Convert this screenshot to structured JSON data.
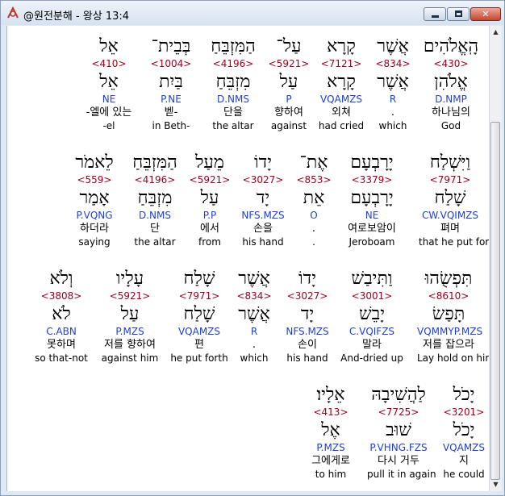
{
  "window": {
    "title": "@원전분해 - 왕상 13:4",
    "close_glyph": "✕"
  },
  "colors": {
    "strong_number": "#a0001e",
    "parsing": "#1f3fd0",
    "title_bar": "#d7e2f0"
  },
  "rows": [
    {
      "words": [
        {
          "heb": "הָֽאֱלֹהִים",
          "num": "<430>",
          "lemma": "אֱלֹהִן",
          "parse": "D.NMP",
          "kor": "하나님의",
          "eng": "God"
        },
        {
          "heb": "אֲשֶׁר",
          "num": "<834>",
          "lemma": "אֲשֶׁר",
          "parse": "R",
          "kor": ".",
          "eng": "which"
        },
        {
          "heb": "קָרָא",
          "num": "<7121>",
          "lemma": "קָרָא",
          "parse": "VQAMZS",
          "kor": "외쳐",
          "eng": "had cried"
        },
        {
          "heb": "עַל־",
          "num": "<5921>",
          "lemma": "עַל",
          "parse": "P",
          "kor": "향하여",
          "eng": "against"
        },
        {
          "heb": "הַמִּזְבֵּחַ",
          "num": "<4196>",
          "lemma": "מִזְבֵּחַ",
          "parse": "D.NMS",
          "kor": "단을",
          "eng": "the altar"
        },
        {
          "heb": "בְּבֵית־",
          "num": "<1004>",
          "lemma": "בַּיִת",
          "parse": "P.NE",
          "kor": "벧-",
          "eng": "in Beth-"
        },
        {
          "heb": "אֵל",
          "num": "<410>",
          "lemma": "אֵל",
          "parse": "NE",
          "kor": "-엘에 있는",
          "eng": "-el"
        }
      ]
    },
    {
      "words": [
        {
          "heb": "וַיִּשְׁלַח",
          "num": "<7971>",
          "lemma": "שָׁלַח",
          "parse": "CW.VQIMZS",
          "kor": "펴며",
          "eng": "that he put forth"
        },
        {
          "heb": "יָרָבְעָם",
          "num": "<3379>",
          "lemma": "יָרָבְעָם",
          "parse": "NE",
          "kor": "여로보암이",
          "eng": "Jeroboam"
        },
        {
          "heb": "אֶת־",
          "num": "<853>",
          "lemma": "אֵת",
          "parse": "O",
          "kor": ".",
          "eng": "."
        },
        {
          "heb": "יָדוֹ",
          "num": "<3027>",
          "lemma": "יָד",
          "parse": "NFS.MZS",
          "kor": "손을",
          "eng": "his hand"
        },
        {
          "heb": "מֵעַל",
          "num": "<5921>",
          "lemma": "עַל",
          "parse": "P.P",
          "kor": "에서",
          "eng": "from"
        },
        {
          "heb": "הַמִּזְבֵּחַ",
          "num": "<4196>",
          "lemma": "מִזְבֵּחַ",
          "parse": "D.NMS",
          "kor": "단",
          "eng": "the altar"
        },
        {
          "heb": "לֵאמֹר",
          "num": "<559>",
          "lemma": "אָמַר",
          "parse": "P.VQNG",
          "kor": "하더라",
          "eng": "saying"
        }
      ]
    },
    {
      "words": [
        {
          "heb": "תִּפְשֻׂהוּ",
          "num": "<8610>",
          "lemma": "תָּפַשׂ",
          "parse": "VQMMYP.MZS",
          "kor": "저를 잡으라",
          "eng": "Lay hold on him"
        },
        {
          "heb": "וַתִּיבַשׁ",
          "num": "<3001>",
          "lemma": "יָבֵשׁ",
          "parse": "C.VQIFZS",
          "kor": "말라",
          "eng": "And-dried up"
        },
        {
          "heb": "יָדוֹ",
          "num": "<3027>",
          "lemma": "יָד",
          "parse": "NFS.MZS",
          "kor": "손이",
          "eng": "his hand"
        },
        {
          "heb": "אֲשֶׁר",
          "num": "<834>",
          "lemma": "אֲשֶׁר",
          "parse": "R",
          "kor": ".",
          "eng": "which"
        },
        {
          "heb": "שָׁלַח",
          "num": "<7971>",
          "lemma": "שָׁלַח",
          "parse": "VQAMZS",
          "kor": "편",
          "eng": "he put forth"
        },
        {
          "heb": "עָלָיו",
          "num": "<5921>",
          "lemma": "עַל",
          "parse": "P.MZS",
          "kor": "저를 향하여",
          "eng": "against him"
        },
        {
          "heb": "וְלֹא",
          "num": "<3808>",
          "lemma": "לֹא",
          "parse": "C.ABN",
          "kor": "못하며",
          "eng": "so that-not"
        }
      ]
    },
    {
      "words": [
        {
          "heb": "יָכֹל",
          "num": "<3201>",
          "lemma": "יָכֹל",
          "parse": "VQAMZS",
          "kor": "지",
          "eng": "he could"
        },
        {
          "heb": "לַהֲשִׁיבָהּ",
          "num": "<7725>",
          "lemma": "שׁוּב",
          "parse": "P.VHNG.FZS",
          "kor": "다시 거두",
          "eng": "pull it in again"
        },
        {
          "heb": "אֵלָיו׃",
          "num": "<413>",
          "lemma": "אֶל",
          "parse": "P.MZS",
          "kor": "그에게로",
          "eng": "to him"
        }
      ]
    }
  ]
}
